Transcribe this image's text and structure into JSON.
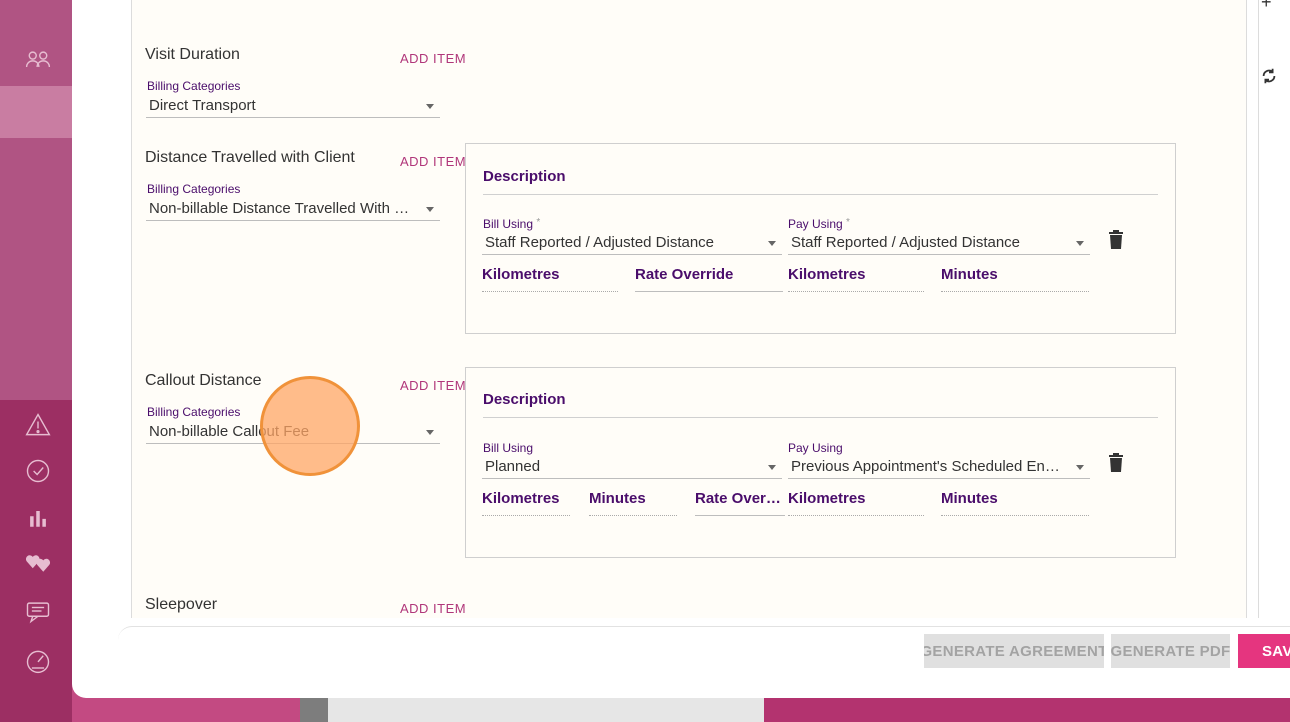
{
  "sections": {
    "visit_duration": {
      "title": "Visit Duration",
      "add_item": "ADD ITEM",
      "billing_label": "Billing Categories",
      "billing_value": "Direct Transport"
    },
    "distance_with_client": {
      "title": "Distance Travelled with Client",
      "add_item": "ADD ITEM",
      "billing_label": "Billing Categories",
      "billing_value": "Non-billable Distance Travelled With Client",
      "card": {
        "description": "Description",
        "bill_using_label": "Bill Using",
        "bill_using_required": "*",
        "bill_using_value": "Staff Reported / Adjusted Distance",
        "pay_using_label": "Pay Using",
        "pay_using_required": "*",
        "pay_using_value": "Staff Reported / Adjusted Distance",
        "fields": [
          "Kilometres",
          "Rate Override",
          "Kilometres",
          "Minutes"
        ]
      }
    },
    "callout_distance": {
      "title": "Callout Distance",
      "add_item": "ADD ITEM",
      "billing_label": "Billing Categories",
      "billing_value": "Non-billable Callout Fee",
      "card": {
        "description": "Description",
        "bill_using_label": "Bill Using",
        "bill_using_value": "Planned",
        "pay_using_label": "Pay Using",
        "pay_using_value": "Previous Appointment's Scheduled End Location",
        "fields": [
          "Kilometres",
          "Minutes",
          "Rate Override",
          "Kilometres",
          "Minutes"
        ]
      }
    },
    "sleepover": {
      "title": "Sleepover",
      "add_item": "ADD ITEM"
    }
  },
  "footer": {
    "generate_agreement": "GENERATE AGREEMENT",
    "generate_pdf": "GENERATE PDF",
    "save": "SAVE"
  },
  "colors": {
    "accent": "#b0367a",
    "label": "#4a0d6b",
    "primary_button": "#e5357f"
  }
}
